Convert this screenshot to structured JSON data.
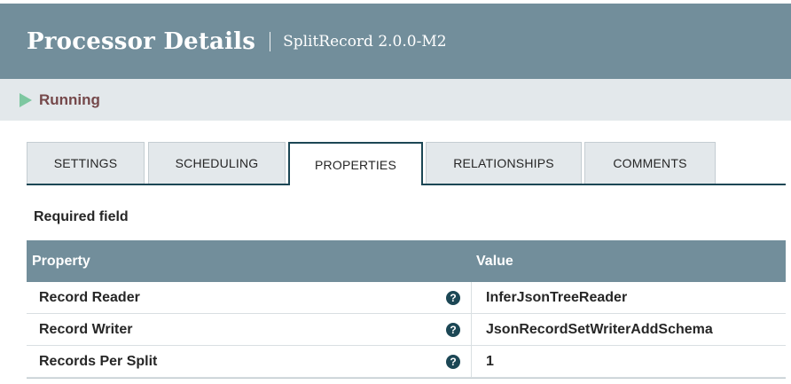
{
  "header": {
    "title": "Processor Details",
    "subtitle": "SplitRecord 2.0.0-M2"
  },
  "status": {
    "label": "Running",
    "icon": "play-icon",
    "color": "#7dc7a0"
  },
  "tabs": [
    {
      "label": "SETTINGS",
      "active": false
    },
    {
      "label": "SCHEDULING",
      "active": false
    },
    {
      "label": "PROPERTIES",
      "active": true
    },
    {
      "label": "RELATIONSHIPS",
      "active": false
    },
    {
      "label": "COMMENTS",
      "active": false
    }
  ],
  "required_label": "Required field",
  "table": {
    "columns": [
      "Property",
      "Value"
    ],
    "rows": [
      {
        "property": "Record Reader",
        "value": "InferJsonTreeReader"
      },
      {
        "property": "Record Writer",
        "value": "JsonRecordSetWriterAddSchema"
      },
      {
        "property": "Records Per Split",
        "value": "1"
      }
    ]
  },
  "colors": {
    "header_bg": "#728e9b",
    "status_bg": "#e3e8eb",
    "status_text": "#75484a",
    "accent": "#1c4755"
  }
}
